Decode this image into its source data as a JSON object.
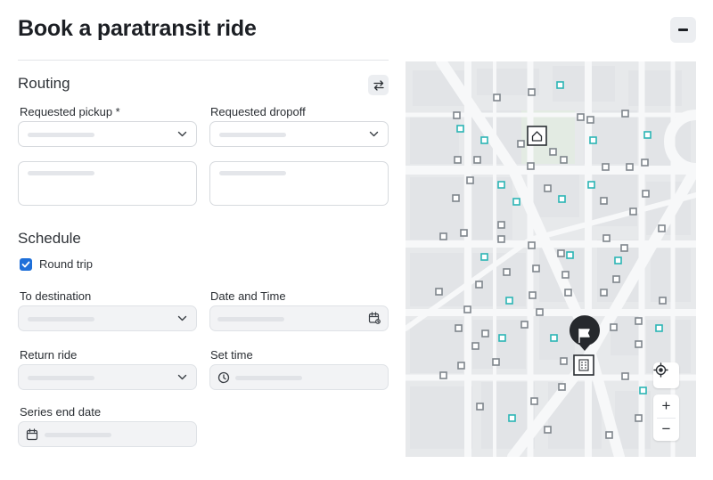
{
  "title": "Book a paratransit ride",
  "header": {
    "collapse_icon": "minus-icon"
  },
  "routing": {
    "heading": "Routing",
    "swap_icon": "swap-arrows-icon",
    "pickup_label": "Requested pickup *",
    "dropoff_label": "Requested dropoff"
  },
  "schedule": {
    "heading": "Schedule",
    "round_trip_label": "Round trip",
    "round_trip_checked": true,
    "to_destination_label": "To destination",
    "date_time_label": "Date and Time",
    "return_ride_label": "Return ride",
    "set_time_label": "Set time",
    "series_end_label": "Series end date"
  },
  "map": {
    "pickup_marker_icon": "home-icon",
    "dropoff_marker_icon": "flag-icon",
    "destination_marker_icon": "building-icon",
    "locate_icon": "crosshair-icon",
    "zoom_in": "+",
    "zoom_out": "−",
    "colors": {
      "stop_gray": "#8a8f96",
      "stop_teal": "#2bb5b5",
      "road": "#f7f8f9",
      "block": "#e6e8ea"
    }
  }
}
